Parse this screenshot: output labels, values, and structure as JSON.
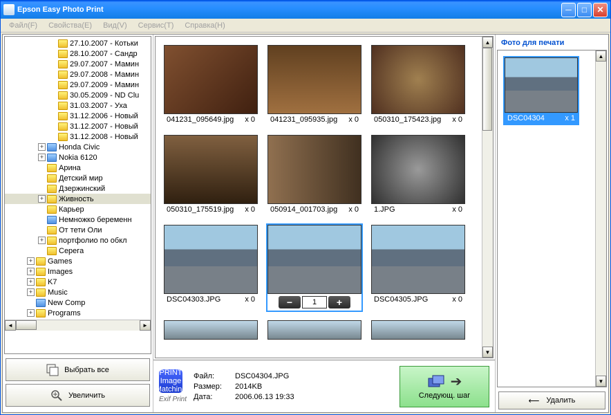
{
  "title": "Epson Easy Photo Print",
  "menus": [
    "Файл(F)",
    "Свойства(E)",
    "Вид(V)",
    "Сервис(T)",
    "Справка(H)"
  ],
  "tree": [
    {
      "d": 4,
      "e": "",
      "i": "y",
      "l": "27.10.2007 - Котьки"
    },
    {
      "d": 4,
      "e": "",
      "i": "y",
      "l": "28.10.2007 - Сандр"
    },
    {
      "d": 4,
      "e": "",
      "i": "y",
      "l": "29.07.2007 - Мамин"
    },
    {
      "d": 4,
      "e": "",
      "i": "y",
      "l": "29.07.2008 - Мамин"
    },
    {
      "d": 4,
      "e": "",
      "i": "y",
      "l": "29.07.2009 - Мамин"
    },
    {
      "d": 4,
      "e": "",
      "i": "y",
      "l": "30.05.2009 - ND Clu"
    },
    {
      "d": 4,
      "e": "",
      "i": "y",
      "l": "31.03.2007 - Уха"
    },
    {
      "d": 4,
      "e": "",
      "i": "y",
      "l": "31.12.2006 - Новый"
    },
    {
      "d": 4,
      "e": "",
      "i": "y",
      "l": "31.12.2007 - Новый"
    },
    {
      "d": 4,
      "e": "",
      "i": "y",
      "l": "31.12.2008 - Новый"
    },
    {
      "d": 3,
      "e": "+",
      "i": "b",
      "l": "Honda Civic"
    },
    {
      "d": 3,
      "e": "+",
      "i": "b",
      "l": "Nokia 6120"
    },
    {
      "d": 3,
      "e": "",
      "i": "y",
      "l": "Арина"
    },
    {
      "d": 3,
      "e": "",
      "i": "y",
      "l": "Детский мир"
    },
    {
      "d": 3,
      "e": "",
      "i": "y",
      "l": "Дзержинский"
    },
    {
      "d": 3,
      "e": "+",
      "i": "y",
      "l": "Живность",
      "sel": true
    },
    {
      "d": 3,
      "e": "",
      "i": "y",
      "l": "Карьер"
    },
    {
      "d": 3,
      "e": "",
      "i": "b",
      "l": "Немножко беременн"
    },
    {
      "d": 3,
      "e": "",
      "i": "y",
      "l": "От тети Оли"
    },
    {
      "d": 3,
      "e": "+",
      "i": "y",
      "l": "портфолио по обкл"
    },
    {
      "d": 3,
      "e": "",
      "i": "y",
      "l": "Серега"
    },
    {
      "d": 2,
      "e": "+",
      "i": "y",
      "l": "Games"
    },
    {
      "d": 2,
      "e": "+",
      "i": "y",
      "l": "Images"
    },
    {
      "d": 2,
      "e": "+",
      "i": "y",
      "l": "K7"
    },
    {
      "d": 2,
      "e": "+",
      "i": "y",
      "l": "Music"
    },
    {
      "d": 2,
      "e": "",
      "i": "b",
      "l": "New Comp"
    },
    {
      "d": 2,
      "e": "+",
      "i": "y",
      "l": "Programs"
    }
  ],
  "btn_select_all": "Выбрать все",
  "btn_zoom": "Увеличить",
  "thumbs": [
    {
      "f": "041231_095649.jpg",
      "c": "x 0",
      "cls": "p-cat1"
    },
    {
      "f": "041231_095935.jpg",
      "c": "x 0",
      "cls": "p-cat2"
    },
    {
      "f": "050310_175423.jpg",
      "c": "x 0",
      "cls": "p-cat3"
    },
    {
      "f": "050310_175519.jpg",
      "c": "x 0",
      "cls": "p-cat4"
    },
    {
      "f": "050914_001703.jpg",
      "c": "x 0",
      "cls": "p-cat5"
    },
    {
      "f": "1.JPG",
      "c": "x 0",
      "cls": "p-cat6"
    },
    {
      "f": "DSC04303.JPG",
      "c": "x 0",
      "cls": "p-bird"
    },
    {
      "f": "DSC04304",
      "c": "",
      "cls": "p-bird",
      "sel": true,
      "qty": "1"
    },
    {
      "f": "DSC04305.JPG",
      "c": "x 0",
      "cls": "p-bird"
    }
  ],
  "right_title": "Фото для печати",
  "right_thumb": {
    "f": "DSC04304",
    "c": "x 1",
    "cls": "p-bird"
  },
  "btn_delete": "Удалить",
  "meta": {
    "file_l": "Файл:",
    "file_v": "DSC04304.JPG",
    "size_l": "Размер:",
    "size_v": "2014KB",
    "date_l": "Дата:",
    "date_v": "2006.06.13 19:33"
  },
  "exif_label": "Exif Print",
  "badge_label": "PRINT Image Matching",
  "btn_next": "Следующ. шаг"
}
